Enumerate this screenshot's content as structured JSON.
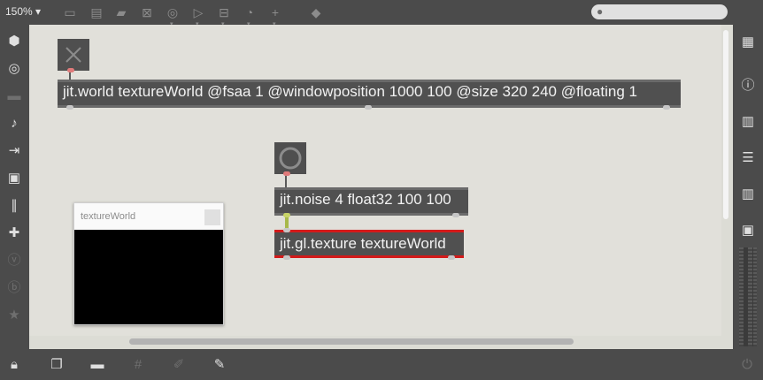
{
  "toolbar": {
    "zoom": "150% ▾",
    "icons": [
      "presentation-icon",
      "comment-icon",
      "comment-bubble-icon",
      "toggle-icon",
      "number-box-icon",
      "play-icon",
      "minus-icon",
      "dial-icon",
      "plus-icon",
      "paint-bucket-icon"
    ],
    "search_placeholder": ""
  },
  "left_sidebar": {
    "icons": [
      "cube-icon",
      "target-icon",
      "keyboard-icon",
      "music-note-icon",
      "step-play-icon",
      "image-icon",
      "paperclip-icon",
      "plug-icon",
      "vimeo-icon",
      "b-icon",
      "star-icon"
    ]
  },
  "right_sidebar": {
    "icons": [
      "grid-icon",
      "info-icon",
      "book-icon",
      "list-icon",
      "open-book-icon",
      "snapshot-icon"
    ]
  },
  "bottom_bar": {
    "icons": [
      "lock-icon",
      "windows-icon",
      "presentation-icon",
      "grid-hash-icon",
      "magnet-icon",
      "wrench-icon",
      "power-icon"
    ]
  },
  "patch": {
    "world_object": "jit.world textureWorld @fsaa 1 @windowposition 1000 100 @size 320 240 @floating 1",
    "noise_object": "jit.noise 4 float32 100 100",
    "texture_object": "jit.gl.texture textureWorld",
    "window_title": "textureWorld"
  },
  "colors": {
    "canvas": "#e1e0da",
    "object_bg": "#505050",
    "texture_accent": "#d41a1a"
  }
}
